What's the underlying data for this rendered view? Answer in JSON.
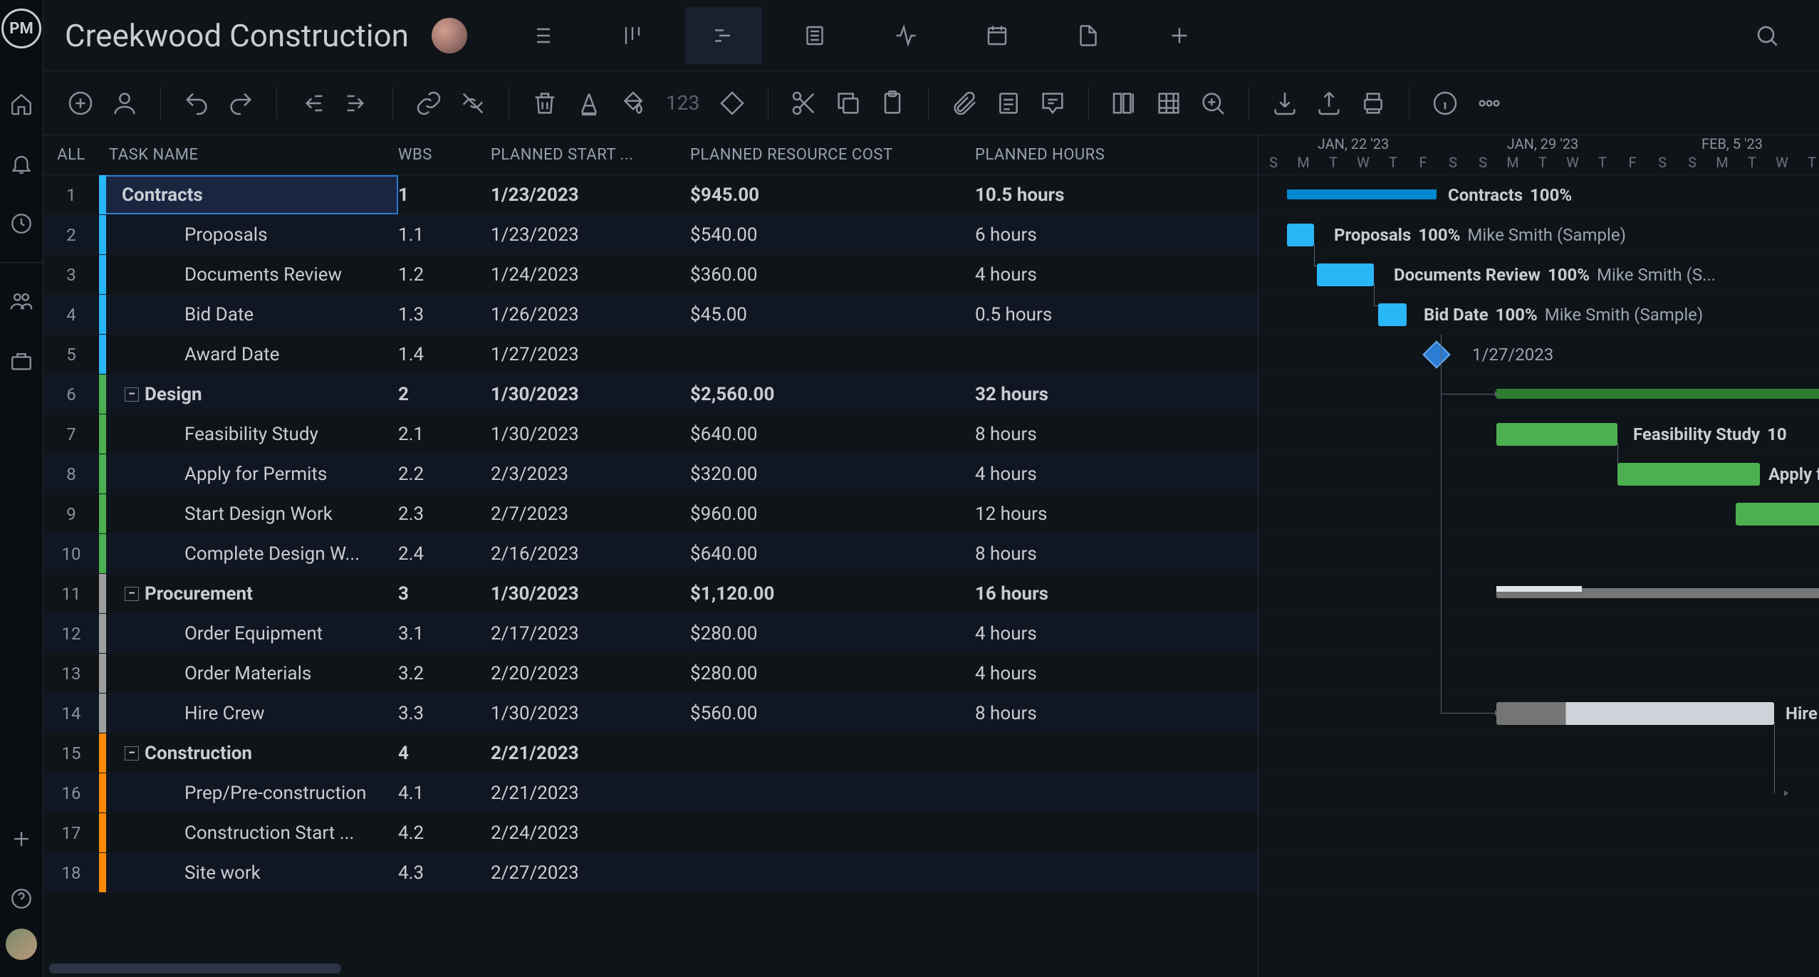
{
  "project_title": "Creekwood Construction",
  "columns": {
    "all": "ALL",
    "task": "TASK NAME",
    "wbs": "WBS",
    "start": "PLANNED START ...",
    "cost": "PLANNED RESOURCE COST",
    "hours": "PLANNED HOURS"
  },
  "toolbar_number": "123",
  "timeline": {
    "weeks": [
      "JAN, 22 '23",
      "JAN, 29 '23",
      "FEB, 5 '23"
    ],
    "days": [
      "S",
      "M",
      "T",
      "W",
      "T",
      "F",
      "S",
      "S",
      "M",
      "T",
      "W",
      "T",
      "F",
      "S",
      "S",
      "M",
      "T",
      "W",
      "T"
    ]
  },
  "rows": [
    {
      "n": "1",
      "name": "Contracts",
      "wbs": "1",
      "start": "1/23/2023",
      "cost": "$945.00",
      "hours": "10.5 hours",
      "cat": "blue",
      "parent": false,
      "bold": true,
      "sel": true,
      "indent": 0
    },
    {
      "n": "2",
      "name": "Proposals",
      "wbs": "1.1",
      "start": "1/23/2023",
      "cost": "$540.00",
      "hours": "6 hours",
      "cat": "blue",
      "parent": false,
      "bold": false,
      "indent": 1
    },
    {
      "n": "3",
      "name": "Documents Review",
      "wbs": "1.2",
      "start": "1/24/2023",
      "cost": "$360.00",
      "hours": "4 hours",
      "cat": "blue",
      "parent": false,
      "bold": false,
      "indent": 1
    },
    {
      "n": "4",
      "name": "Bid Date",
      "wbs": "1.3",
      "start": "1/26/2023",
      "cost": "$45.00",
      "hours": "0.5 hours",
      "cat": "blue",
      "parent": false,
      "bold": false,
      "indent": 1
    },
    {
      "n": "5",
      "name": "Award Date",
      "wbs": "1.4",
      "start": "1/27/2023",
      "cost": "",
      "hours": "",
      "cat": "blue",
      "parent": false,
      "bold": false,
      "indent": 1
    },
    {
      "n": "6",
      "name": "Design",
      "wbs": "2",
      "start": "1/30/2023",
      "cost": "$2,560.00",
      "hours": "32 hours",
      "cat": "green",
      "parent": true,
      "bold": true,
      "indent": 0
    },
    {
      "n": "7",
      "name": "Feasibility Study",
      "wbs": "2.1",
      "start": "1/30/2023",
      "cost": "$640.00",
      "hours": "8 hours",
      "cat": "green",
      "parent": false,
      "bold": false,
      "indent": 1
    },
    {
      "n": "8",
      "name": "Apply for Permits",
      "wbs": "2.2",
      "start": "2/3/2023",
      "cost": "$320.00",
      "hours": "4 hours",
      "cat": "green",
      "parent": false,
      "bold": false,
      "indent": 1
    },
    {
      "n": "9",
      "name": "Start Design Work",
      "wbs": "2.3",
      "start": "2/7/2023",
      "cost": "$960.00",
      "hours": "12 hours",
      "cat": "green",
      "parent": false,
      "bold": false,
      "indent": 1
    },
    {
      "n": "10",
      "name": "Complete Design W...",
      "wbs": "2.4",
      "start": "2/16/2023",
      "cost": "$640.00",
      "hours": "8 hours",
      "cat": "green",
      "parent": false,
      "bold": false,
      "indent": 1
    },
    {
      "n": "11",
      "name": "Procurement",
      "wbs": "3",
      "start": "1/30/2023",
      "cost": "$1,120.00",
      "hours": "16 hours",
      "cat": "grey",
      "parent": true,
      "bold": true,
      "indent": 0
    },
    {
      "n": "12",
      "name": "Order Equipment",
      "wbs": "3.1",
      "start": "2/17/2023",
      "cost": "$280.00",
      "hours": "4 hours",
      "cat": "grey",
      "parent": false,
      "bold": false,
      "indent": 1
    },
    {
      "n": "13",
      "name": "Order Materials",
      "wbs": "3.2",
      "start": "2/20/2023",
      "cost": "$280.00",
      "hours": "4 hours",
      "cat": "grey",
      "parent": false,
      "bold": false,
      "indent": 1
    },
    {
      "n": "14",
      "name": "Hire Crew",
      "wbs": "3.3",
      "start": "1/30/2023",
      "cost": "$560.00",
      "hours": "8 hours",
      "cat": "grey",
      "parent": false,
      "bold": false,
      "indent": 1
    },
    {
      "n": "15",
      "name": "Construction",
      "wbs": "4",
      "start": "2/21/2023",
      "cost": "",
      "hours": "",
      "cat": "orange",
      "parent": true,
      "bold": true,
      "indent": 0
    },
    {
      "n": "16",
      "name": "Prep/Pre-construction",
      "wbs": "4.1",
      "start": "2/21/2023",
      "cost": "",
      "hours": "",
      "cat": "orange",
      "parent": false,
      "bold": false,
      "indent": 1
    },
    {
      "n": "17",
      "name": "Construction Start ...",
      "wbs": "4.2",
      "start": "2/24/2023",
      "cost": "",
      "hours": "",
      "cat": "orange",
      "parent": false,
      "bold": false,
      "indent": 1
    },
    {
      "n": "18",
      "name": "Site work",
      "wbs": "4.3",
      "start": "2/27/2023",
      "cost": "",
      "hours": "",
      "cat": "orange",
      "parent": false,
      "bold": false,
      "indent": 1
    }
  ],
  "gantt_labels": {
    "contracts": {
      "name": "Contracts",
      "pct": "100%"
    },
    "proposals": {
      "name": "Proposals",
      "pct": "100%",
      "assignee": "Mike Smith (Sample)"
    },
    "docs": {
      "name": "Documents Review",
      "pct": "100%",
      "assignee": "Mike Smith (S..."
    },
    "bid": {
      "name": "Bid Date",
      "pct": "100%",
      "assignee": "Mike Smith (Sample)"
    },
    "award": {
      "date": "1/27/2023"
    },
    "feas": {
      "name": "Feasibility Study",
      "pct": "10"
    },
    "apply": {
      "name": "Apply f"
    },
    "hire": {
      "name": "Hire"
    }
  },
  "logo_text": "PM"
}
